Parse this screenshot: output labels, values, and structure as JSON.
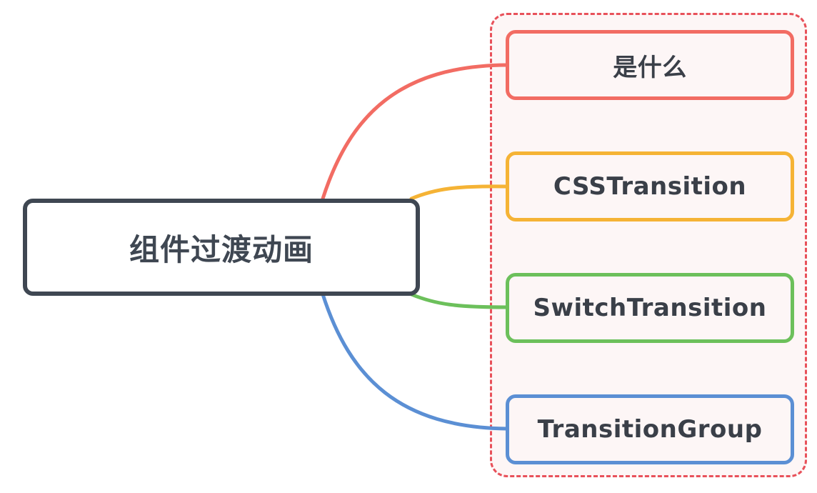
{
  "root": {
    "label": "组件过渡动画"
  },
  "children": [
    {
      "label": "是什么",
      "color": "#f26c63"
    },
    {
      "label": "CSSTransition",
      "color": "#f5b335"
    },
    {
      "label": "SwitchTransition",
      "color": "#6cc05b"
    },
    {
      "label": "TransitionGroup",
      "color": "#5b8fd4"
    }
  ],
  "colors": {
    "root_border": "#3f4752",
    "group_frame": "#e8515a",
    "node_fill": "#fdf6f6"
  }
}
